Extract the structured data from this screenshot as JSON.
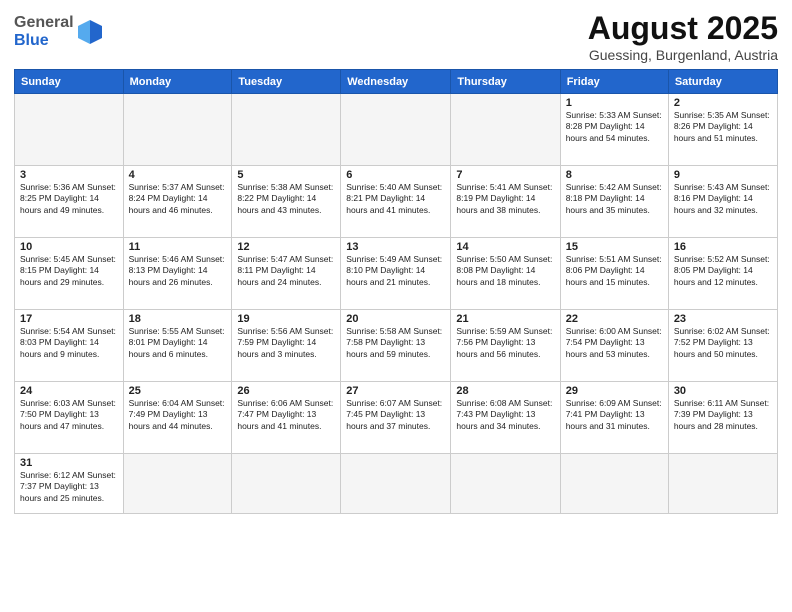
{
  "header": {
    "logo_general": "General",
    "logo_blue": "Blue",
    "month_title": "August 2025",
    "subtitle": "Guessing, Burgenland, Austria"
  },
  "weekdays": [
    "Sunday",
    "Monday",
    "Tuesday",
    "Wednesday",
    "Thursday",
    "Friday",
    "Saturday"
  ],
  "weeks": [
    [
      {
        "day": "",
        "info": ""
      },
      {
        "day": "",
        "info": ""
      },
      {
        "day": "",
        "info": ""
      },
      {
        "day": "",
        "info": ""
      },
      {
        "day": "",
        "info": ""
      },
      {
        "day": "1",
        "info": "Sunrise: 5:33 AM\nSunset: 8:28 PM\nDaylight: 14 hours\nand 54 minutes."
      },
      {
        "day": "2",
        "info": "Sunrise: 5:35 AM\nSunset: 8:26 PM\nDaylight: 14 hours\nand 51 minutes."
      }
    ],
    [
      {
        "day": "3",
        "info": "Sunrise: 5:36 AM\nSunset: 8:25 PM\nDaylight: 14 hours\nand 49 minutes."
      },
      {
        "day": "4",
        "info": "Sunrise: 5:37 AM\nSunset: 8:24 PM\nDaylight: 14 hours\nand 46 minutes."
      },
      {
        "day": "5",
        "info": "Sunrise: 5:38 AM\nSunset: 8:22 PM\nDaylight: 14 hours\nand 43 minutes."
      },
      {
        "day": "6",
        "info": "Sunrise: 5:40 AM\nSunset: 8:21 PM\nDaylight: 14 hours\nand 41 minutes."
      },
      {
        "day": "7",
        "info": "Sunrise: 5:41 AM\nSunset: 8:19 PM\nDaylight: 14 hours\nand 38 minutes."
      },
      {
        "day": "8",
        "info": "Sunrise: 5:42 AM\nSunset: 8:18 PM\nDaylight: 14 hours\nand 35 minutes."
      },
      {
        "day": "9",
        "info": "Sunrise: 5:43 AM\nSunset: 8:16 PM\nDaylight: 14 hours\nand 32 minutes."
      }
    ],
    [
      {
        "day": "10",
        "info": "Sunrise: 5:45 AM\nSunset: 8:15 PM\nDaylight: 14 hours\nand 29 minutes."
      },
      {
        "day": "11",
        "info": "Sunrise: 5:46 AM\nSunset: 8:13 PM\nDaylight: 14 hours\nand 26 minutes."
      },
      {
        "day": "12",
        "info": "Sunrise: 5:47 AM\nSunset: 8:11 PM\nDaylight: 14 hours\nand 24 minutes."
      },
      {
        "day": "13",
        "info": "Sunrise: 5:49 AM\nSunset: 8:10 PM\nDaylight: 14 hours\nand 21 minutes."
      },
      {
        "day": "14",
        "info": "Sunrise: 5:50 AM\nSunset: 8:08 PM\nDaylight: 14 hours\nand 18 minutes."
      },
      {
        "day": "15",
        "info": "Sunrise: 5:51 AM\nSunset: 8:06 PM\nDaylight: 14 hours\nand 15 minutes."
      },
      {
        "day": "16",
        "info": "Sunrise: 5:52 AM\nSunset: 8:05 PM\nDaylight: 14 hours\nand 12 minutes."
      }
    ],
    [
      {
        "day": "17",
        "info": "Sunrise: 5:54 AM\nSunset: 8:03 PM\nDaylight: 14 hours\nand 9 minutes."
      },
      {
        "day": "18",
        "info": "Sunrise: 5:55 AM\nSunset: 8:01 PM\nDaylight: 14 hours\nand 6 minutes."
      },
      {
        "day": "19",
        "info": "Sunrise: 5:56 AM\nSunset: 7:59 PM\nDaylight: 14 hours\nand 3 minutes."
      },
      {
        "day": "20",
        "info": "Sunrise: 5:58 AM\nSunset: 7:58 PM\nDaylight: 13 hours\nand 59 minutes."
      },
      {
        "day": "21",
        "info": "Sunrise: 5:59 AM\nSunset: 7:56 PM\nDaylight: 13 hours\nand 56 minutes."
      },
      {
        "day": "22",
        "info": "Sunrise: 6:00 AM\nSunset: 7:54 PM\nDaylight: 13 hours\nand 53 minutes."
      },
      {
        "day": "23",
        "info": "Sunrise: 6:02 AM\nSunset: 7:52 PM\nDaylight: 13 hours\nand 50 minutes."
      }
    ],
    [
      {
        "day": "24",
        "info": "Sunrise: 6:03 AM\nSunset: 7:50 PM\nDaylight: 13 hours\nand 47 minutes."
      },
      {
        "day": "25",
        "info": "Sunrise: 6:04 AM\nSunset: 7:49 PM\nDaylight: 13 hours\nand 44 minutes."
      },
      {
        "day": "26",
        "info": "Sunrise: 6:06 AM\nSunset: 7:47 PM\nDaylight: 13 hours\nand 41 minutes."
      },
      {
        "day": "27",
        "info": "Sunrise: 6:07 AM\nSunset: 7:45 PM\nDaylight: 13 hours\nand 37 minutes."
      },
      {
        "day": "28",
        "info": "Sunrise: 6:08 AM\nSunset: 7:43 PM\nDaylight: 13 hours\nand 34 minutes."
      },
      {
        "day": "29",
        "info": "Sunrise: 6:09 AM\nSunset: 7:41 PM\nDaylight: 13 hours\nand 31 minutes."
      },
      {
        "day": "30",
        "info": "Sunrise: 6:11 AM\nSunset: 7:39 PM\nDaylight: 13 hours\nand 28 minutes."
      }
    ],
    [
      {
        "day": "31",
        "info": "Sunrise: 6:12 AM\nSunset: 7:37 PM\nDaylight: 13 hours\nand 25 minutes."
      },
      {
        "day": "",
        "info": ""
      },
      {
        "day": "",
        "info": ""
      },
      {
        "day": "",
        "info": ""
      },
      {
        "day": "",
        "info": ""
      },
      {
        "day": "",
        "info": ""
      },
      {
        "day": "",
        "info": ""
      }
    ]
  ]
}
